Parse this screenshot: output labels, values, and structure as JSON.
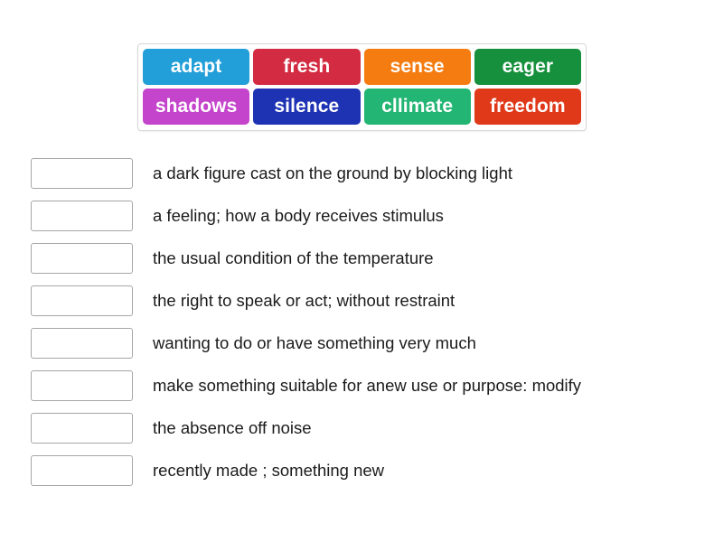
{
  "activity": {
    "type": "match-up",
    "word_bank": {
      "rows": [
        [
          {
            "label": "adapt",
            "color": "#229FD8"
          },
          {
            "label": "fresh",
            "color": "#D32B41"
          },
          {
            "label": "sense",
            "color": "#F57C11"
          },
          {
            "label": "eager",
            "color": "#16903C"
          }
        ],
        [
          {
            "label": "shadows",
            "color": "#C544CC"
          },
          {
            "label": "silence",
            "color": "#1E32B4"
          },
          {
            "label": "cllimate",
            "color": "#22B573"
          },
          {
            "label": "freedom",
            "color": "#E0391A"
          }
        ]
      ]
    },
    "items": [
      {
        "answer": "",
        "definition": "a dark figure cast on the ground by blocking light"
      },
      {
        "answer": "",
        "definition": "a feeling; how a body receives stimulus"
      },
      {
        "answer": "",
        "definition": "the usual condition of the temperature"
      },
      {
        "answer": "",
        "definition": "the right to speak or act; without restraint"
      },
      {
        "answer": "",
        "definition": "wanting to do or have something very much"
      },
      {
        "answer": "",
        "definition": "make something suitable for anew use or purpose: modify"
      },
      {
        "answer": "",
        "definition": "the absence off noise"
      },
      {
        "answer": "",
        "definition": "recently made ; something new"
      }
    ]
  }
}
